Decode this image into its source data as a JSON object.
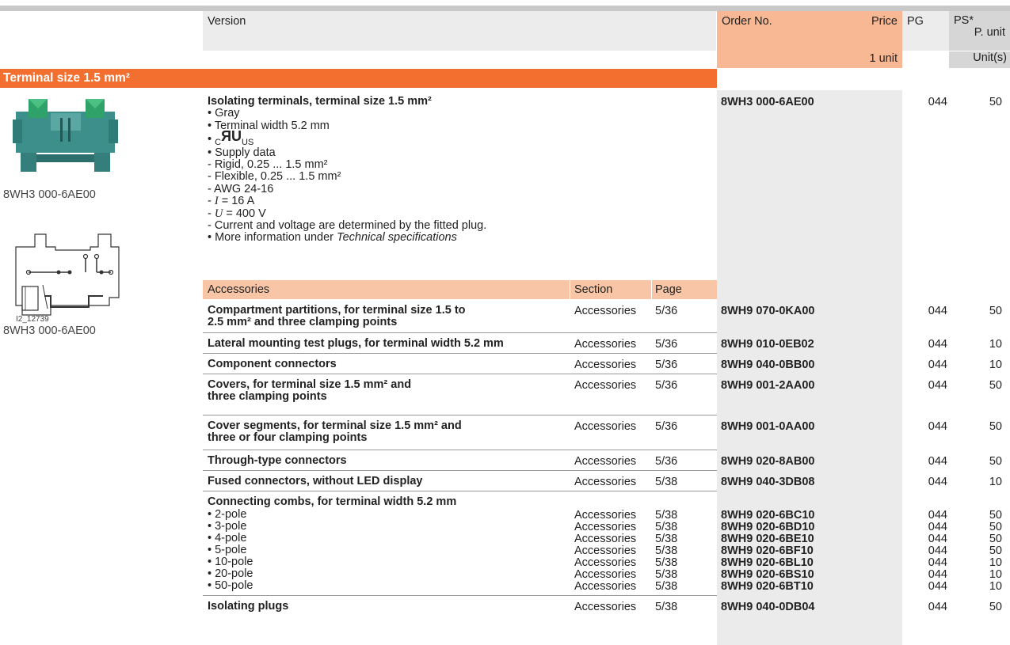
{
  "header": {
    "version": "Version",
    "order_no": "Order No.",
    "price": "Price",
    "price_unit": "1 unit",
    "pg": "PG",
    "ps": "PS*",
    "ps_sub": "P. unit",
    "ps_unit": "Unit(s)"
  },
  "section_title": "Terminal size 1.5 mm²",
  "images": {
    "caption1": "8WH3 000-6AE00",
    "diagram_id": "I2_12739",
    "caption2": "8WH3 000-6AE00"
  },
  "main": {
    "title": "Isolating terminals, terminal size 1.5 mm²",
    "b1": "• Gray",
    "b2": "• Terminal width 5.2 mm",
    "b3_bullet": "•",
    "ul_c": "C",
    "ul_mark": "ЯU",
    "ul_us": "US",
    "b4": "• Supply data",
    "d1": "- Rigid, 0.25 ... 1.5 mm²",
    "d2": "- Flexible, 0.25 ... 1.5 mm²",
    "d3": "- AWG 24-16",
    "d4_pre": "- ",
    "d4_sym": "I",
    "d4_val": " = 16 A",
    "d5_pre": "- ",
    "d5_sym": "U",
    "d5_val": " = 400 V",
    "d6": "- Current and voltage are determined by the fitted plug.",
    "b5_pre": "• More information under ",
    "b5_it": "Technical specifications",
    "order": "8WH3 000-6AE00",
    "pg": "044",
    "ps": "50"
  },
  "accessories_header": {
    "label": "Accessories",
    "section": "Section",
    "page": "Page"
  },
  "rows": [
    {
      "v1": "Compartment partitions, for terminal size 1.5 to",
      "v2": "2.5 mm² and three clamping points",
      "section": "Accessories",
      "page": "5/36",
      "order": "8WH9 070-0KA00",
      "pg": "044",
      "ps": "50"
    },
    {
      "v1": "Lateral mounting test plugs, for terminal width 5.2 mm",
      "v2": "",
      "section": "Accessories",
      "page": "5/36",
      "order": "8WH9 010-0EB02",
      "pg": "044",
      "ps": "10"
    },
    {
      "v1": "Component connectors",
      "v2": "",
      "section": "Accessories",
      "page": "5/36",
      "order": "8WH9 040-0BB00",
      "pg": "044",
      "ps": "10"
    },
    {
      "v1": "Covers, for terminal size 1.5 mm² and",
      "v2": "three clamping points",
      "section": "Accessories",
      "page": "5/36",
      "order": "8WH9 001-2AA00",
      "pg": "044",
      "ps": "50"
    },
    {
      "v1": "Cover segments, for terminal size 1.5 mm² and",
      "v2": "three or four clamping points",
      "section": "Accessories",
      "page": "5/36",
      "order": "8WH9 001-0AA00",
      "pg": "044",
      "ps": "50"
    },
    {
      "v1": "Through-type connectors",
      "v2": "",
      "section": "Accessories",
      "page": "5/36",
      "order": "8WH9 020-8AB00",
      "pg": "044",
      "ps": "50"
    },
    {
      "v1": "Fused connectors, without LED display",
      "v2": "",
      "section": "Accessories",
      "page": "5/38",
      "order": "8WH9 040-3DB08",
      "pg": "044",
      "ps": "10"
    }
  ],
  "combs": {
    "title": "Connecting combs, for terminal width 5.2 mm",
    "items": [
      {
        "label": "• 2-pole",
        "section": "Accessories",
        "page": "5/38",
        "order": "8WH9 020-6BC10",
        "pg": "044",
        "ps": "50"
      },
      {
        "label": "• 3-pole",
        "section": "Accessories",
        "page": "5/38",
        "order": "8WH9 020-6BD10",
        "pg": "044",
        "ps": "50"
      },
      {
        "label": "• 4-pole",
        "section": "Accessories",
        "page": "5/38",
        "order": "8WH9 020-6BE10",
        "pg": "044",
        "ps": "50"
      },
      {
        "label": "• 5-pole",
        "section": "Accessories",
        "page": "5/38",
        "order": "8WH9 020-6BF10",
        "pg": "044",
        "ps": "50"
      },
      {
        "label": "• 10-pole",
        "section": "Accessories",
        "page": "5/38",
        "order": "8WH9 020-6BL10",
        "pg": "044",
        "ps": "10"
      },
      {
        "label": "• 20-pole",
        "section": "Accessories",
        "page": "5/38",
        "order": "8WH9 020-6BS10",
        "pg": "044",
        "ps": "10"
      },
      {
        "label": "• 50-pole",
        "section": "Accessories",
        "page": "5/38",
        "order": "8WH9 020-6BT10",
        "pg": "044",
        "ps": "10"
      }
    ]
  },
  "last_row": {
    "v1": "Isolating plugs",
    "section": "Accessories",
    "page": "5/38",
    "order": "8WH9 040-0DB04",
    "pg": "044",
    "ps": "50"
  }
}
